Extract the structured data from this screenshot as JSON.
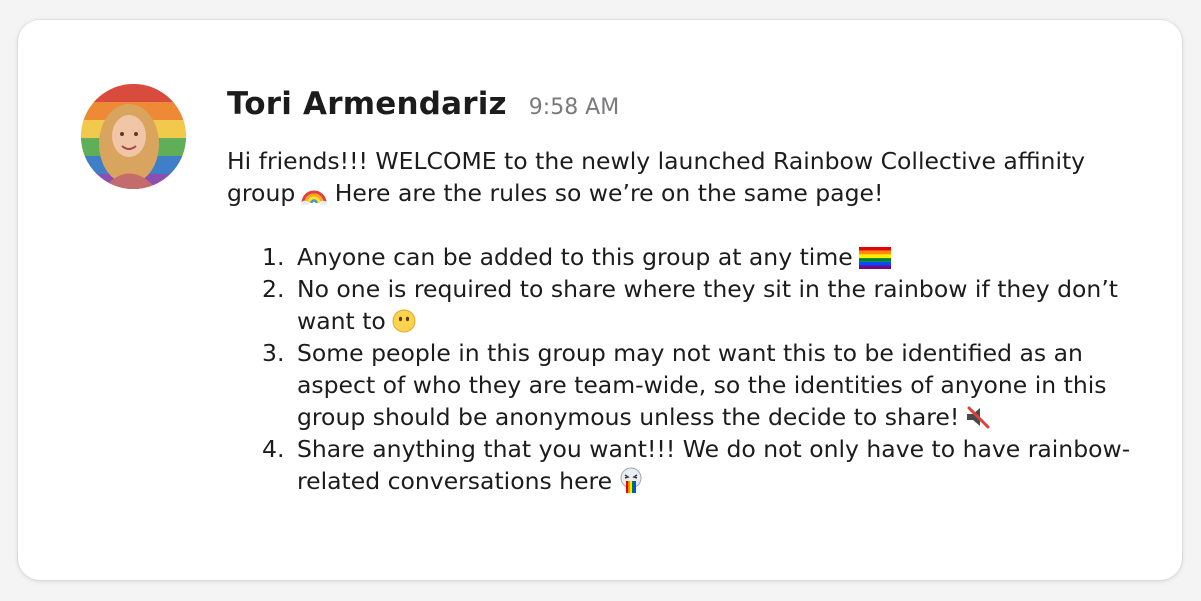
{
  "message": {
    "author": "Tori Armendariz",
    "timestamp": "9:58 AM",
    "intro_before_emoji": "Hi friends!!! WELCOME to the newly launched Rainbow Collective affinity group",
    "intro_after_emoji": " Here are the rules so we’re on the same page!",
    "rules": [
      {
        "number": "1.",
        "text": "Anyone can be added to this group at any time",
        "emoji": "rainbow-flag-icon"
      },
      {
        "number": "2.",
        "text": "No one is required to share where they sit in the rainbow if they don’t want to",
        "emoji": "no-mouth-face-icon"
      },
      {
        "number": "3.",
        "text": "Some people in this group may not want this to be identified as an aspect of who they are team-wide, so the identities of anyone in this group should be anonymous unless the decide to share!",
        "emoji": "muted-speaker-icon"
      },
      {
        "number": "4.",
        "text": "Share anything that you want!!! We do not only have to have rainbow-related conversations here",
        "emoji": "rainbow-puke-icon"
      }
    ]
  },
  "icons": {
    "intro_emoji": "rainbow-icon",
    "avatar": "avatar"
  },
  "colors": {
    "text": "#1d1c1d",
    "timestamp": "#7a7a7d",
    "card": "#ffffff",
    "background": "#f4f4f5"
  }
}
